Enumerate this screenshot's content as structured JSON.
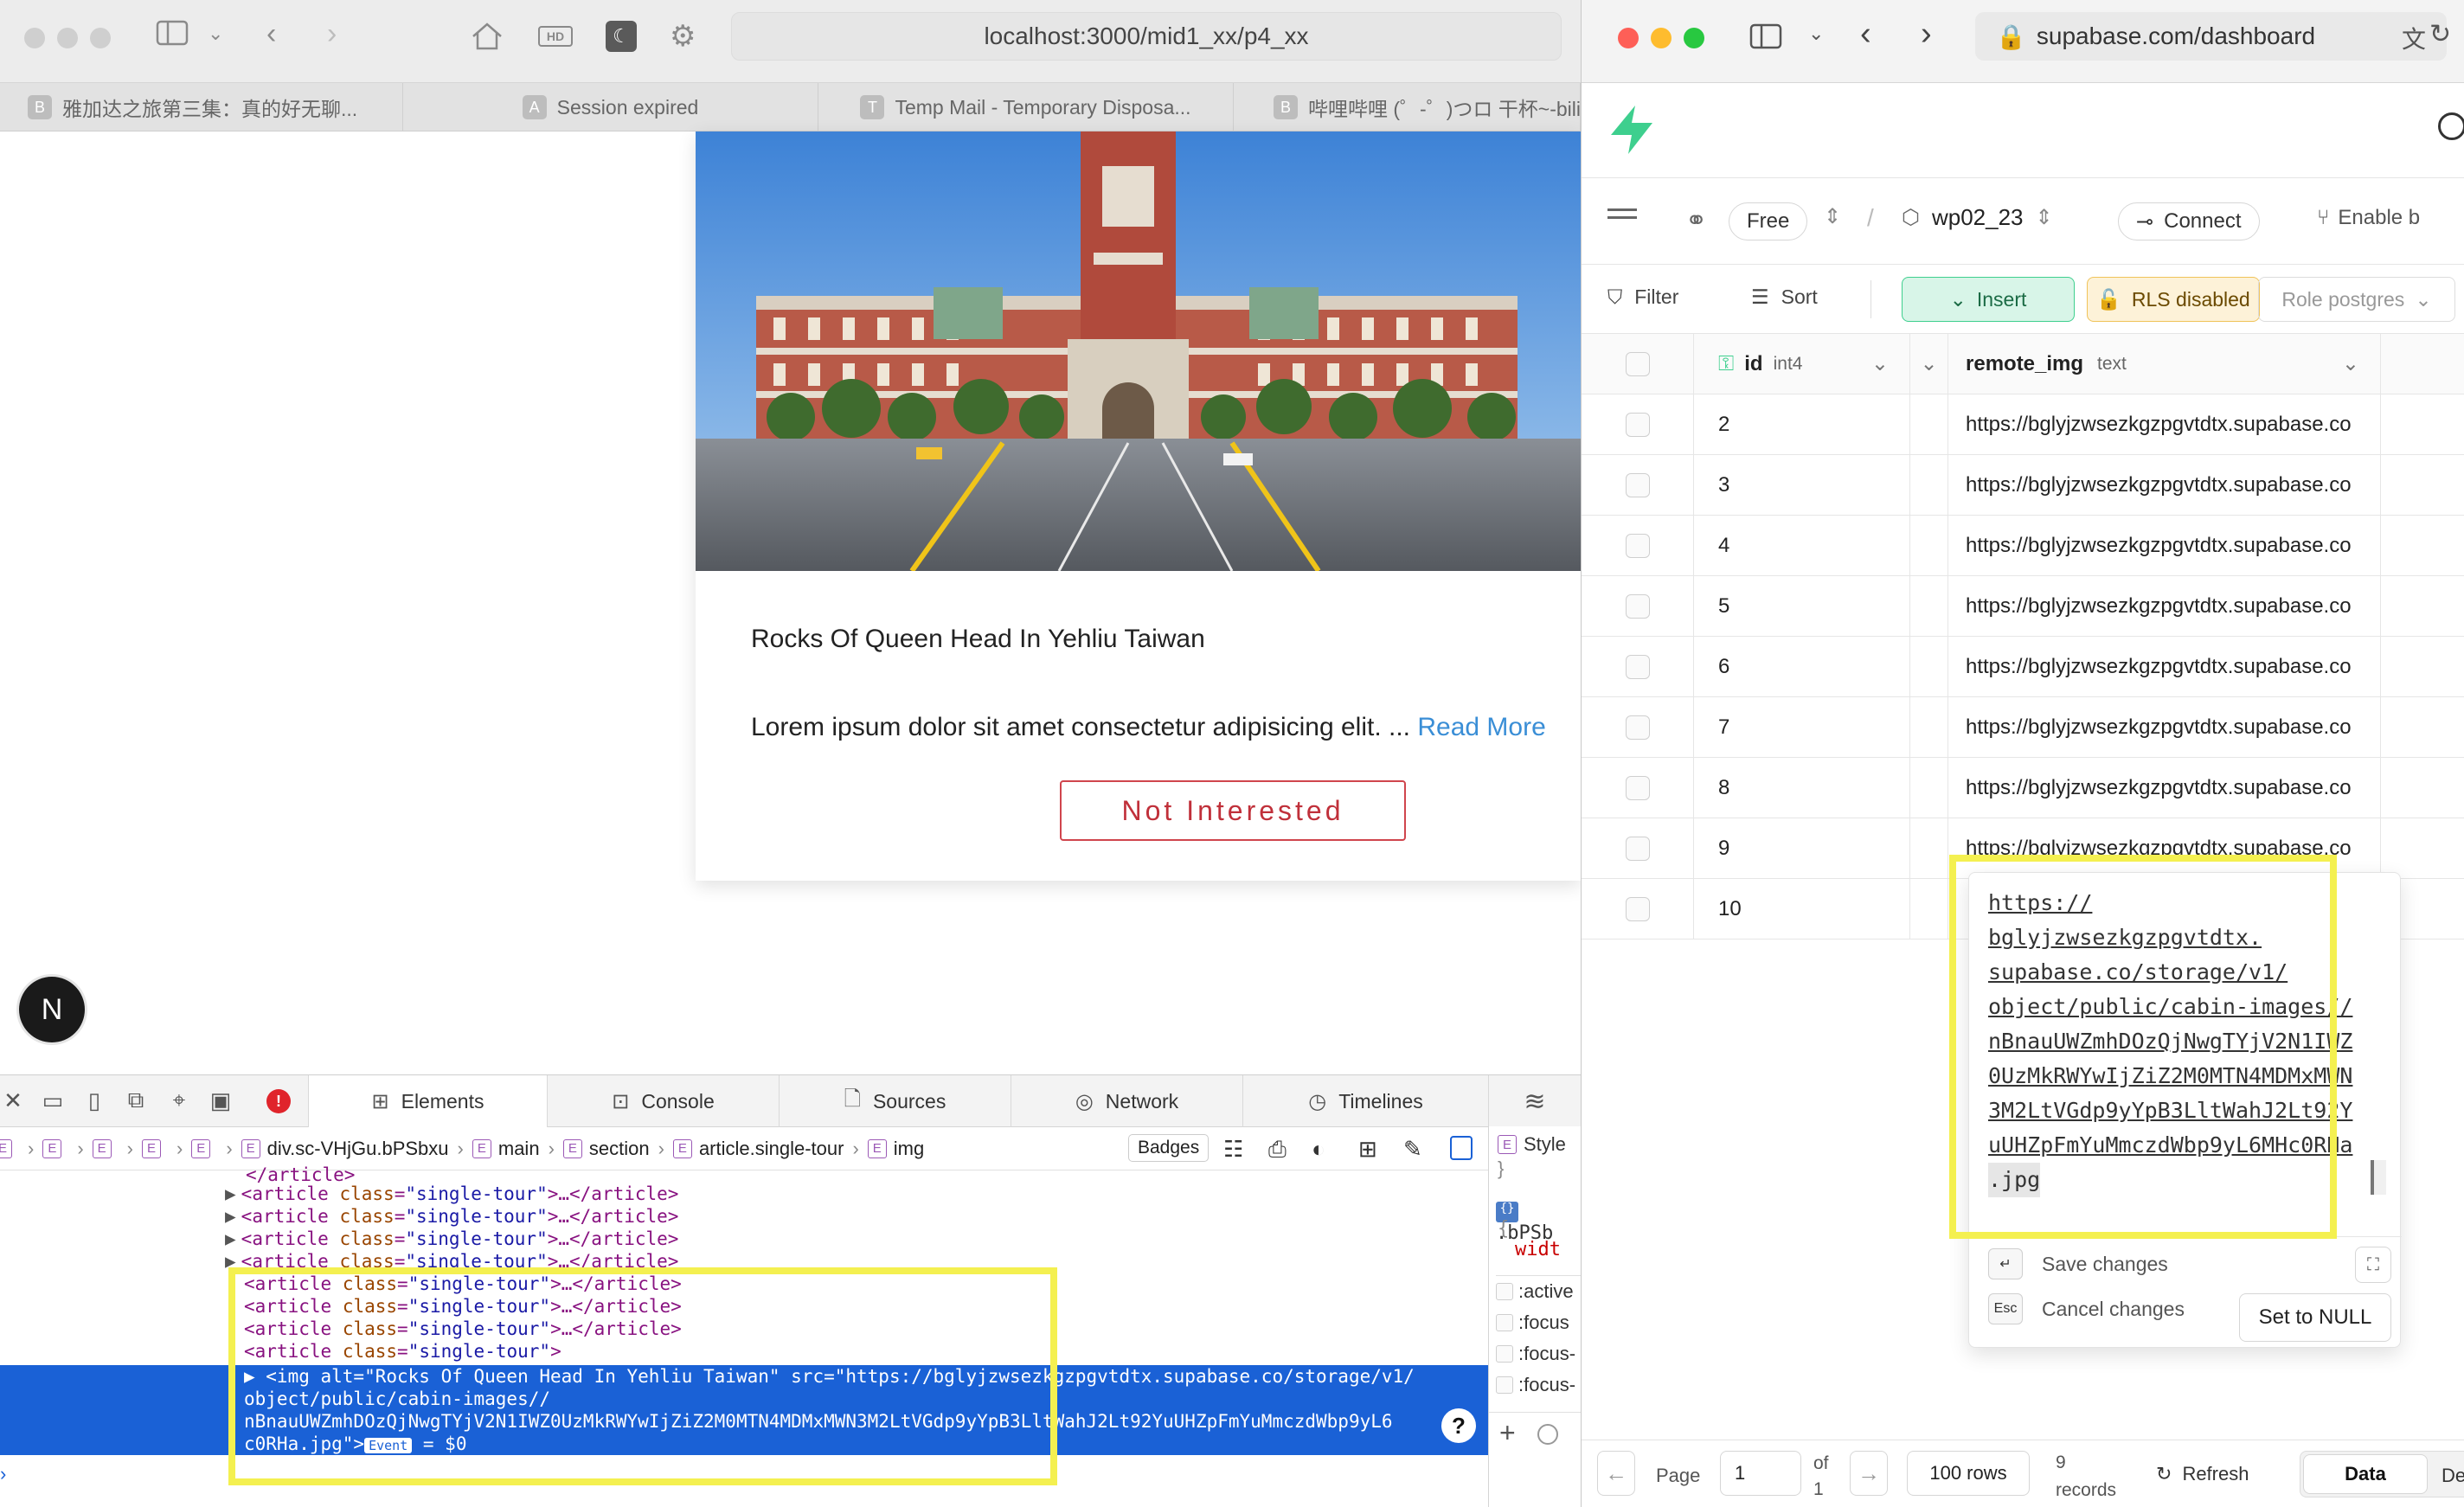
{
  "left_browser": {
    "url": "localhost:3000/mid1_xx/p4_xx",
    "hd_label": "HD",
    "tabs": [
      {
        "favicon": "B",
        "title": "雅加达之旅第三集：真的好无聊..."
      },
      {
        "favicon": "A",
        "title": "Session expired"
      },
      {
        "favicon": "T",
        "title": "Temp Mail - Temporary Disposa..."
      },
      {
        "favicon": "B",
        "title": "哔哩哔哩 (゜-゜)つロ 干杯~-bilibili"
      }
    ]
  },
  "tour_card": {
    "title": "Rocks Of Queen Head In Yehliu Taiwan",
    "info": "Lorem ipsum dolor sit amet consectetur adipisicing elit. ...",
    "read_more": "Read More",
    "not_interested": "Not Interested"
  },
  "next_badge": "N",
  "devtools": {
    "tabs": [
      {
        "label": "Elements",
        "icon": "elements-icon"
      },
      {
        "label": "Console",
        "icon": "console-icon"
      },
      {
        "label": "Sources",
        "icon": "sources-icon"
      },
      {
        "label": "Network",
        "icon": "network-icon"
      },
      {
        "label": "Timelines",
        "icon": "timelines-icon"
      }
    ],
    "breadcrumb": [
      "div.sc-VHjGu.bPSbxu",
      "main",
      "section",
      "article.single-tour",
      "img"
    ],
    "badges_label": "Badges",
    "closing_article": "</article>",
    "article_line_tag": "article",
    "article_line_attr": "class",
    "article_line_value": "\"single-tour\"",
    "article_collapsed_suffix": ">…</article>",
    "selected_line1": "▶ <img alt=\"Rocks Of Queen Head In Yehliu Taiwan\" src=\"https://bglyjzwsezkgzpgvtdtx.supabase.co/storage/v1/",
    "selected_line2": "object/public/cabin-images//",
    "selected_line3": "nBnauUWZmhDOzQjNwgTYjV2N1IWZ0UzMkRWYwIjZiZ2M0MTN4MDMxMWN3M2LtVGdp9yYpB3LltWahJ2Lt92YuUHZpFmYuMmczdWbp9yL6",
    "selected_line4": "c0RHa.jpg\">",
    "event_label": "Event",
    "dollar_ref": "= $0",
    "style_panel": {
      "title": "Style",
      "brace": "}",
      "selector": ".bPSb",
      "brace_open": "{",
      "prop": "widt",
      "states": [
        ":active",
        ":focus",
        ":focus-",
        ":focus-"
      ]
    }
  },
  "right_browser": {
    "url": "supabase.com/dashboard",
    "project": {
      "plan": "Free",
      "name": "wp02_23",
      "connect": "Connect",
      "enable": "Enable b"
    },
    "toolbar": {
      "filter": "Filter",
      "sort": "Sort",
      "insert": "Insert",
      "rls": "RLS disabled",
      "role": "Role postgres"
    },
    "columns": [
      {
        "name": "id",
        "type": "int4"
      },
      {
        "name": "remote_img",
        "type": "text"
      }
    ],
    "rows": [
      {
        "id": "2",
        "remote_img": "https://bglyjzwsezkgzpgvtdtx.supabase.co"
      },
      {
        "id": "3",
        "remote_img": "https://bglyjzwsezkgzpgvtdtx.supabase.co"
      },
      {
        "id": "4",
        "remote_img": "https://bglyjzwsezkgzpgvtdtx.supabase.co"
      },
      {
        "id": "5",
        "remote_img": "https://bglyjzwsezkgzpgvtdtx.supabase.co"
      },
      {
        "id": "6",
        "remote_img": "https://bglyjzwsezkgzpgvtdtx.supabase.co"
      },
      {
        "id": "7",
        "remote_img": "https://bglyjzwsezkgzpgvtdtx.supabase.co"
      },
      {
        "id": "8",
        "remote_img": "https://bglyjzwsezkgzpgvtdtx.supabase.co"
      },
      {
        "id": "9",
        "remote_img": "https://bglyjzwsezkgzpgvtdtx.supabase.co"
      },
      {
        "id": "10",
        "remote_img": ""
      }
    ],
    "editor": {
      "lines": [
        "https://",
        "bglyjzwsezkgzpgvtdtx.",
        "supabase.co/storage/v1/",
        "object/public/cabin-images//",
        "nBnauUWZmhDOzQjNwgTYjV2N1IWZ",
        "0UzMkRWYwIjZiZ2M0MTN4MDMxMWN",
        "3M2LtVGdp9yYpB3LltWahJ2Lt92Y",
        "uUHZpFmYuMmczdWbp9yL6MHc0RHa",
        ".jpg"
      ],
      "save_key": "↵",
      "save": "Save changes",
      "cancel_key": "Esc",
      "cancel": "Cancel changes",
      "set_null": "Set to NULL"
    },
    "footer": {
      "page_label": "Page",
      "page": "1",
      "of": "of",
      "of_total": "1",
      "rows": "100 rows",
      "records_count": "9",
      "records_label": "records",
      "refresh": "Refresh",
      "data": "Data",
      "definition": "De"
    }
  },
  "colors": {
    "highlight": "#f4f050",
    "selection": "#1a61d6",
    "supabase_green": "#3ecf8e",
    "danger": "#c0303a"
  }
}
